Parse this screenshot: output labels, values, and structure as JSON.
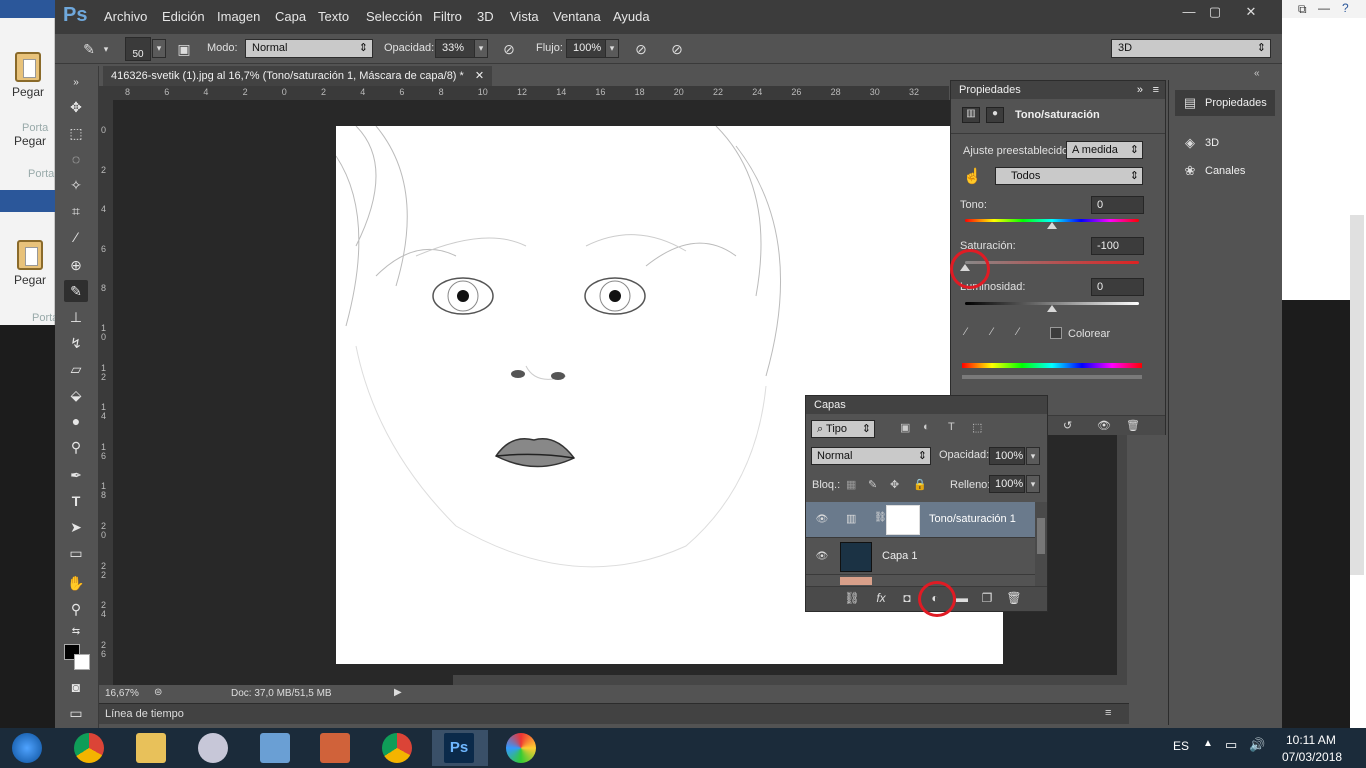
{
  "word_bg": {
    "paste_label": "Pegar",
    "porta_label": "Porta"
  },
  "menubar": {
    "logo": "Ps",
    "items": [
      "Archivo",
      "Edición",
      "Imagen",
      "Capa",
      "Texto",
      "Selección",
      "Filtro",
      "3D",
      "Vista",
      "Ventana",
      "Ayuda"
    ],
    "window_controls": [
      "—",
      "▢",
      "✕"
    ]
  },
  "options_bar": {
    "brush_size": "50",
    "mode_label": "Modo:",
    "mode_value": "Normal",
    "opacity_label": "Opacidad:",
    "opacity_value": "33%",
    "flow_label": "Flujo:",
    "flow_value": "100%",
    "workspace": "3D"
  },
  "document": {
    "tab_title": "416326-svetik (1).jpg al 16,7% (Tono/saturación 1, Máscara de capa/8) *",
    "close_glyph": "✕",
    "h_ruler_ticks": [
      "8",
      "6",
      "4",
      "2",
      "0",
      "2",
      "4",
      "6",
      "8",
      "10",
      "12",
      "14",
      "16",
      "18",
      "20",
      "22",
      "24",
      "26",
      "28",
      "30",
      "32"
    ],
    "v_ruler_ticks": [
      "0",
      "2",
      "4",
      "6",
      "8",
      "10",
      "12",
      "14",
      "16",
      "18",
      "20",
      "22",
      "24",
      "26"
    ],
    "zoom": "16,67%",
    "doc_info": "Doc: 37,0 MB/51,5 MB"
  },
  "timeline": {
    "label": "Línea de tiempo"
  },
  "properties_panel": {
    "tab": "Propiedades",
    "title": "Tono/saturación",
    "preset_label": "Ajuste preestablecido:",
    "preset_value": "A medida",
    "channel_value": "Todos",
    "hue_label": "Tono:",
    "hue_value": "0",
    "saturation_label": "Saturación:",
    "saturation_value": "-100",
    "lightness_label": "Luminosidad:",
    "lightness_value": "0",
    "colorize_label": "Colorear"
  },
  "dock": {
    "items": [
      "Propiedades",
      "3D",
      "Canales"
    ]
  },
  "layers_panel": {
    "tab": "Capas",
    "filter_kind": "Tipo",
    "blend_mode": "Normal",
    "opacity_label": "Opacidad:",
    "opacity_value": "100%",
    "lock_label": "Bloq.:",
    "fill_label": "Relleno:",
    "fill_value": "100%",
    "layers": [
      {
        "name": "Tono/saturación 1",
        "selected": true
      },
      {
        "name": "Capa 1",
        "selected": false
      }
    ]
  },
  "taskbar": {
    "language": "ES",
    "time": "10:11 AM",
    "date": "07/03/2018"
  },
  "colors": {
    "ps_dark": "#3c3c3c",
    "ps_panel": "#535353",
    "highlight_circle": "#e01b24",
    "taskbar": "#1b2b3a"
  }
}
